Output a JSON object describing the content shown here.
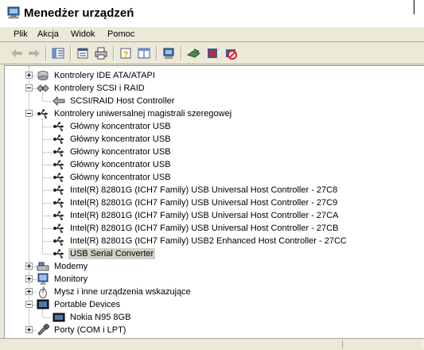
{
  "window": {
    "title": "Menedżer urządzeń"
  },
  "menu": [
    "Plik",
    "Akcja",
    "Widok",
    "Pomoc"
  ],
  "toolbar": {
    "buttons": [
      "back-arrow-icon",
      "forward-arrow-icon",
      "show-hide-console-tree-icon",
      "properties-icon",
      "print-icon",
      "help-icon",
      "details-view-icon",
      "scan-hardware-icon",
      "update-driver-icon",
      "uninstall-icon",
      "disable-icon"
    ]
  },
  "tree": {
    "rows": [
      {
        "label": "Kontrolery IDE ATA/ATAPI",
        "level": 0,
        "expander": "plus",
        "icon": "ide-controller-icon"
      },
      {
        "label": "Kontrolery SCSI i RAID",
        "level": 0,
        "expander": "minus",
        "icon": "scsi-controller-icon"
      },
      {
        "label": "SCSI/RAID Host Controller",
        "level": 1,
        "expander": "",
        "icon": "scsi-device-icon"
      },
      {
        "label": "Kontrolery uniwersalnej magistrali szeregowej",
        "level": 0,
        "expander": "minus",
        "icon": "usb-icon"
      },
      {
        "label": "Główny koncentrator USB",
        "level": 1,
        "expander": "",
        "icon": "usb-icon"
      },
      {
        "label": "Główny koncentrator USB",
        "level": 1,
        "expander": "",
        "icon": "usb-icon"
      },
      {
        "label": "Główny koncentrator USB",
        "level": 1,
        "expander": "",
        "icon": "usb-icon"
      },
      {
        "label": "Główny koncentrator USB",
        "level": 1,
        "expander": "",
        "icon": "usb-icon"
      },
      {
        "label": "Główny koncentrator USB",
        "level": 1,
        "expander": "",
        "icon": "usb-icon"
      },
      {
        "label": "Intel(R) 82801G (ICH7 Family) USB Universal Host Controller - 27C8",
        "level": 1,
        "expander": "",
        "icon": "usb-icon"
      },
      {
        "label": "Intel(R) 82801G (ICH7 Family) USB Universal Host Controller - 27C9",
        "level": 1,
        "expander": "",
        "icon": "usb-icon"
      },
      {
        "label": "Intel(R) 82801G (ICH7 Family) USB Universal Host Controller - 27CA",
        "level": 1,
        "expander": "",
        "icon": "usb-icon"
      },
      {
        "label": "Intel(R) 82801G (ICH7 Family) USB Universal Host Controller - 27CB",
        "level": 1,
        "expander": "",
        "icon": "usb-icon"
      },
      {
        "label": "Intel(R) 82801G (ICH7 Family) USB2 Enhanced Host Controller - 27CC",
        "level": 1,
        "expander": "",
        "icon": "usb-icon"
      },
      {
        "label": "USB Serial Converter",
        "level": 1,
        "expander": "",
        "icon": "usb-icon",
        "selected": true
      },
      {
        "label": "Modemy",
        "level": 0,
        "expander": "plus",
        "icon": "modem-icon"
      },
      {
        "label": "Monitory",
        "level": 0,
        "expander": "plus",
        "icon": "monitor-icon"
      },
      {
        "label": "Mysz i inne urządzenia wskazujące",
        "level": 0,
        "expander": "plus",
        "icon": "mouse-icon"
      },
      {
        "label": "Portable Devices",
        "level": 0,
        "expander": "minus",
        "icon": "portable-devices-icon"
      },
      {
        "label": "Nokia N95 8GB",
        "level": 1,
        "expander": "",
        "icon": "portable-device-icon"
      },
      {
        "label": "Porty (COM i LPT)",
        "level": 0,
        "expander": "plus",
        "icon": "port-icon"
      }
    ]
  },
  "colors": {
    "selection": "#d4d0c8",
    "tree_bg": "#ffffff",
    "chrome": "#ece9d8"
  }
}
